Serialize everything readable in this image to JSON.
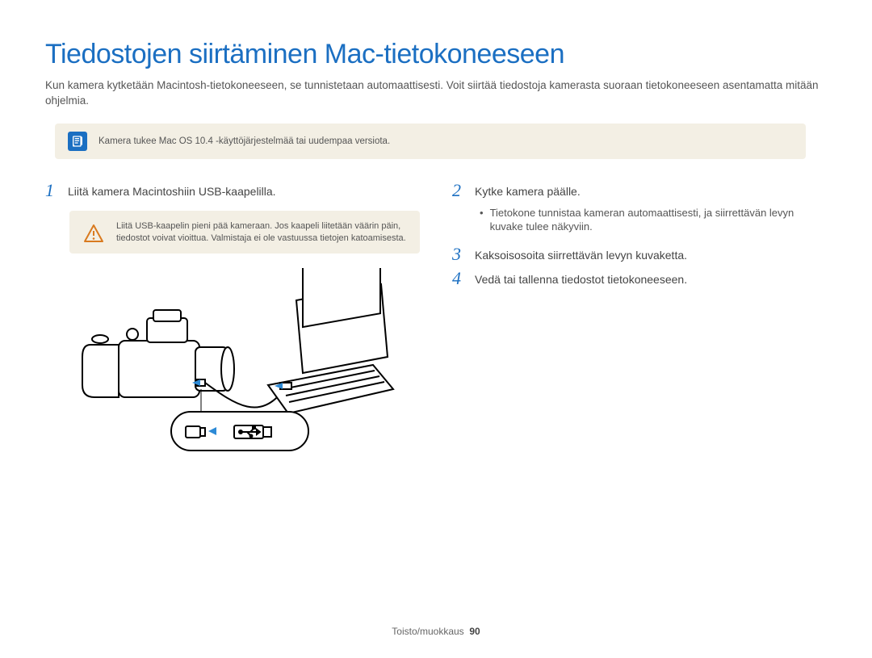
{
  "title": "Tiedostojen siirtäminen Mac-tietokoneeseen",
  "intro": "Kun kamera kytketään Macintosh-tietokoneeseen, se tunnistetaan automaattisesti. Voit siirtää tiedostoja kamerasta suoraan tietokoneeseen asentamatta mitään ohjelmia.",
  "info_note": "Kamera tukee Mac OS 10.4 -käyttöjärjestelmää tai uudempaa versiota.",
  "steps": {
    "s1_num": "1",
    "s1": "Liitä kamera Macintoshiin USB-kaapelilla.",
    "s1_warn": "Liitä USB-kaapelin pieni pää kameraan. Jos kaapeli liitetään väärin päin, tiedostot voivat vioittua. Valmistaja ei ole vastuussa tietojen katoamisesta.",
    "s2_num": "2",
    "s2": "Kytke kamera päälle.",
    "s2_bullet": "Tietokone tunnistaa kameran automaattisesti, ja siirrettävän levyn kuvake tulee näkyviin.",
    "s3_num": "3",
    "s3": "Kaksoisosoita siirrettävän levyn kuvaketta.",
    "s4_num": "4",
    "s4": "Vedä tai tallenna tiedostot tietokoneeseen."
  },
  "footer_section": "Toisto/muokkaus",
  "footer_page": "90"
}
